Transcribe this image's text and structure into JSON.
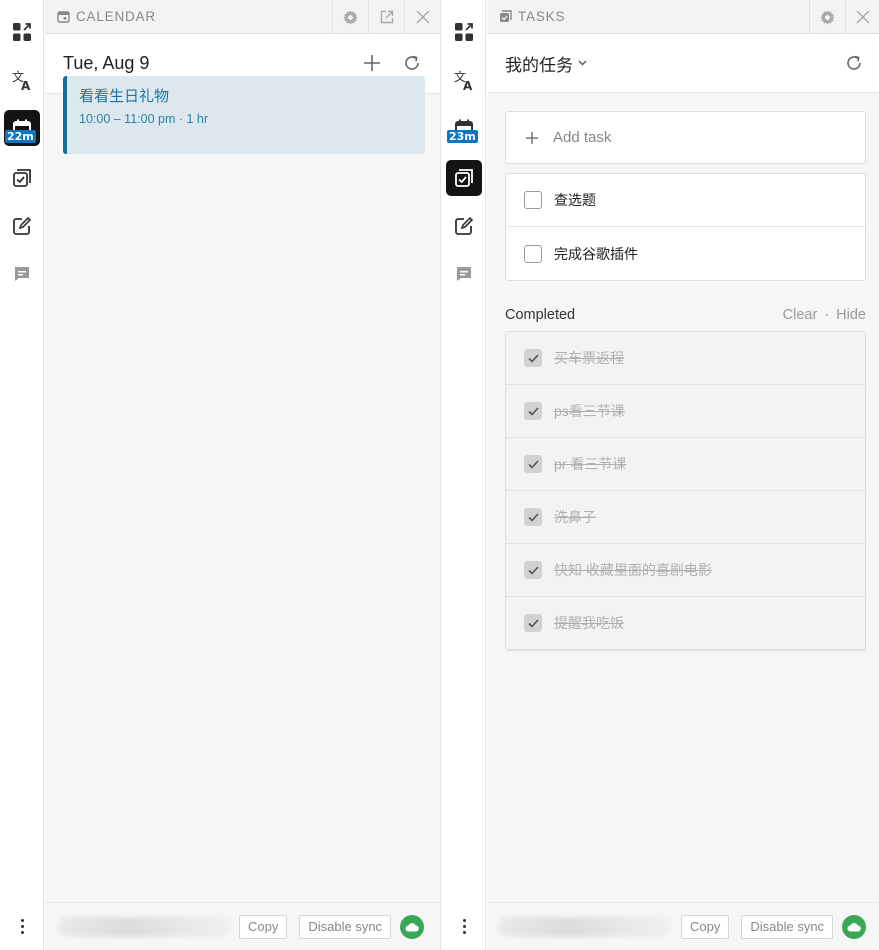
{
  "rail1": {
    "badge": "22m"
  },
  "rail2": {
    "badge": "23m"
  },
  "calendar": {
    "header_title": "CALENDAR",
    "date": "Tue, Aug 9",
    "event": {
      "title": "看看生日礼物",
      "time": "10:00 – 11:00 pm · 1 hr"
    },
    "footer": {
      "copy": "Copy",
      "disable_sync": "Disable sync"
    }
  },
  "tasks": {
    "header_title": "TASKS",
    "list_name": "我的任务",
    "add_task": "Add task",
    "open_tasks": [
      {
        "label": "查选题"
      },
      {
        "label": "完成谷歌插件"
      }
    ],
    "completed_label": "Completed",
    "clear": "Clear",
    "separator": "·",
    "hide": "Hide",
    "completed_tasks": [
      {
        "label": "买车票返程"
      },
      {
        "label": "ps看三节课"
      },
      {
        "label": "pr 看三节课"
      },
      {
        "label": "洗鼻子"
      },
      {
        "label": "快知 收藏里面的喜剧电影"
      },
      {
        "label": "提醒我吃饭"
      }
    ],
    "footer": {
      "copy": "Copy",
      "disable_sync": "Disable sync"
    }
  },
  "colors": {
    "accent": "#14719f",
    "badge": "#0b77c2",
    "sync": "#3aa757",
    "active_rail": "#141414"
  },
  "icons": [
    "widgets-icon",
    "translate-icon",
    "calendar-icon",
    "tasks-icon",
    "notes-icon",
    "chat-icon",
    "more-icon",
    "settings-icon",
    "popout-icon",
    "close-icon",
    "plus-icon",
    "refresh-icon",
    "cloud-icon",
    "chevron-down-icon"
  ]
}
